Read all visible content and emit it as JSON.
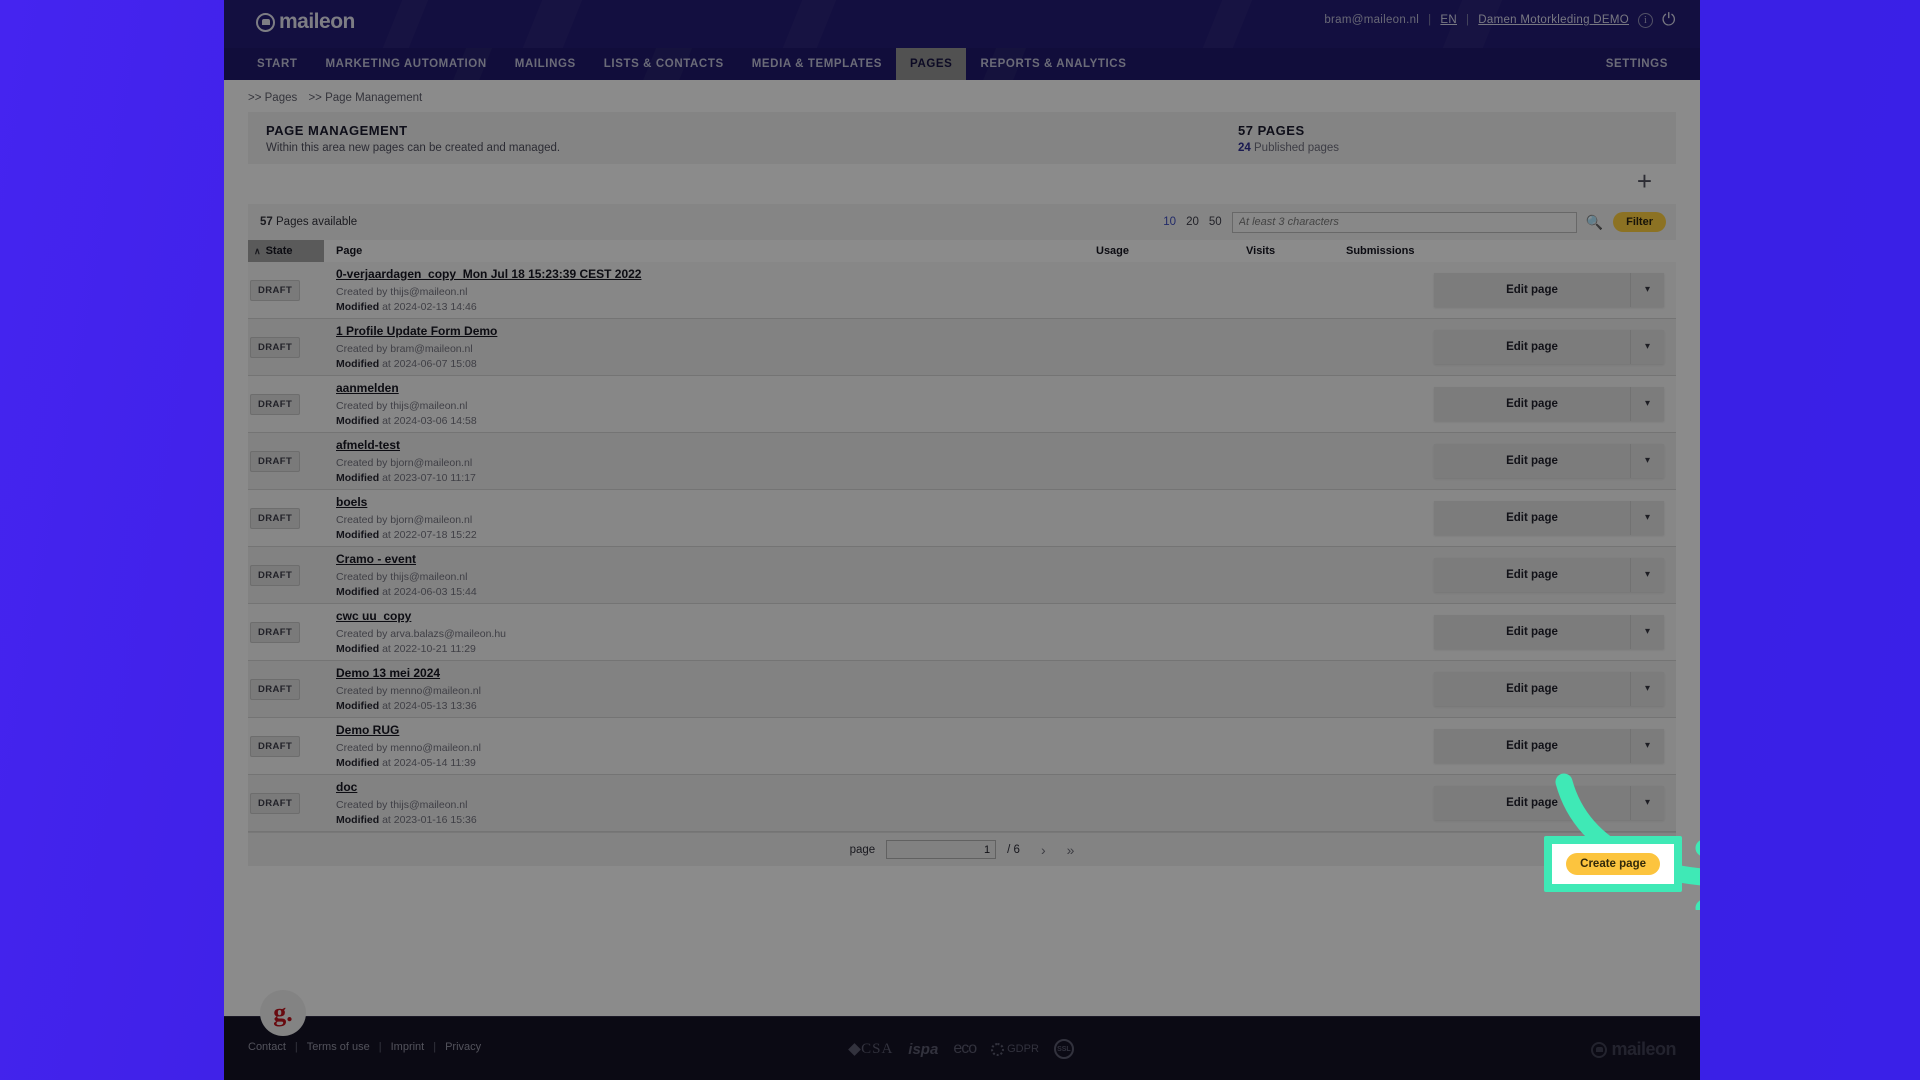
{
  "header": {
    "logo_text": "maileon",
    "user_email": "bram@maileon.nl",
    "language": "EN",
    "account": "Damen Motorkleding DEMO",
    "sep": "|"
  },
  "nav": {
    "items": [
      {
        "label": "START",
        "active": false
      },
      {
        "label": "MARKETING AUTOMATION",
        "active": false
      },
      {
        "label": "MAILINGS",
        "active": false
      },
      {
        "label": "LISTS & CONTACTS",
        "active": false
      },
      {
        "label": "MEDIA & TEMPLATES",
        "active": false
      },
      {
        "label": "PAGES",
        "active": true
      },
      {
        "label": "REPORTS & ANALYTICS",
        "active": false
      }
    ],
    "settings": "SETTINGS"
  },
  "breadcrumb": {
    "part1": ">> Pages",
    "part2": ">> Page Management"
  },
  "titleblock": {
    "title": "PAGE MANAGEMENT",
    "subtitle": "Within this area new pages can be created and managed.",
    "count": "57 PAGES",
    "published_number": "24",
    "published_label": "Published pages"
  },
  "toolbar": {
    "available_number": "57",
    "available_label": "Pages available",
    "page_sizes": [
      "10",
      "20",
      "50"
    ],
    "page_size_selected": "10",
    "search_placeholder": "At least 3 characters",
    "search_value": "",
    "filter_label": "Filter",
    "add_icon": "plus-icon",
    "search_icon": "search-icon"
  },
  "table": {
    "columns": {
      "state": "State",
      "page": "Page",
      "usage": "Usage",
      "visits": "Visits",
      "submissions": "Submissions"
    },
    "sort_caret": "∧",
    "action_label": "Edit page",
    "action_caret": "⌄",
    "rows": [
      {
        "state": "DRAFT",
        "name": "0-verjaardagen_copy_Mon Jul 18 15:23:39 CEST 2022",
        "created_label": "Created by",
        "created_by": "thijs@maileon.nl",
        "modified_label": "Modified",
        "modified_at": "at 2024-02-13 14:46"
      },
      {
        "state": "DRAFT",
        "name": "1 Profile Update Form Demo",
        "created_label": "Created by",
        "created_by": "bram@maileon.nl",
        "modified_label": "Modified",
        "modified_at": "at 2024-06-07 15:08"
      },
      {
        "state": "DRAFT",
        "name": "aanmelden",
        "created_label": "Created by",
        "created_by": "thijs@maileon.nl",
        "modified_label": "Modified",
        "modified_at": "at 2024-03-06 14:58"
      },
      {
        "state": "DRAFT",
        "name": "afmeld-test",
        "created_label": "Created by",
        "created_by": "bjorn@maileon.nl",
        "modified_label": "Modified",
        "modified_at": "at 2023-07-10 11:17"
      },
      {
        "state": "DRAFT",
        "name": "boels",
        "created_label": "Created by",
        "created_by": "bjorn@maileon.nl",
        "modified_label": "Modified",
        "modified_at": "at 2022-07-18 15:22"
      },
      {
        "state": "DRAFT",
        "name": "Cramo - event",
        "created_label": "Created by",
        "created_by": "thijs@maileon.nl",
        "modified_label": "Modified",
        "modified_at": "at 2024-06-03 15:44"
      },
      {
        "state": "DRAFT",
        "name": "cwc uu_copy",
        "created_label": "Created by",
        "created_by": "arva.balazs@maileon.hu",
        "modified_label": "Modified",
        "modified_at": "at 2022-10-21 11:29"
      },
      {
        "state": "DRAFT",
        "name": "Demo 13 mei 2024",
        "created_label": "Created by",
        "created_by": "menno@maileon.nl",
        "modified_label": "Modified",
        "modified_at": "at 2024-05-13 13:36"
      },
      {
        "state": "DRAFT",
        "name": "Demo RUG",
        "created_label": "Created by",
        "created_by": "menno@maileon.nl",
        "modified_label": "Modified",
        "modified_at": "at 2024-05-14 11:39"
      },
      {
        "state": "DRAFT",
        "name": "doc",
        "created_label": "Created by",
        "created_by": "thijs@maileon.nl",
        "modified_label": "Modified",
        "modified_at": "at 2023-01-16 15:36"
      }
    ]
  },
  "pagination": {
    "label": "page",
    "current": "1",
    "total": "/ 6",
    "next_icon": "›",
    "last_icon": "»"
  },
  "create": {
    "label": "Create page"
  },
  "footer": {
    "links": [
      "Contact",
      "Terms of use",
      "Imprint",
      "Privacy"
    ],
    "sep": "|",
    "certs": [
      "CSA",
      "ispa",
      "eco",
      "GDPR",
      "SSL"
    ],
    "logo_text": "maileon"
  },
  "badge": {
    "text": "g."
  },
  "colors": {
    "brand_purple": "#221a6e",
    "nav_purple": "#1e1866",
    "backdrop": "#3a20e8",
    "filter_yellow": "#f2c53d",
    "create_yellow": "#fcc43e",
    "highlight_mint": "#3fe9b6",
    "link_blue": "#3a49b5"
  }
}
